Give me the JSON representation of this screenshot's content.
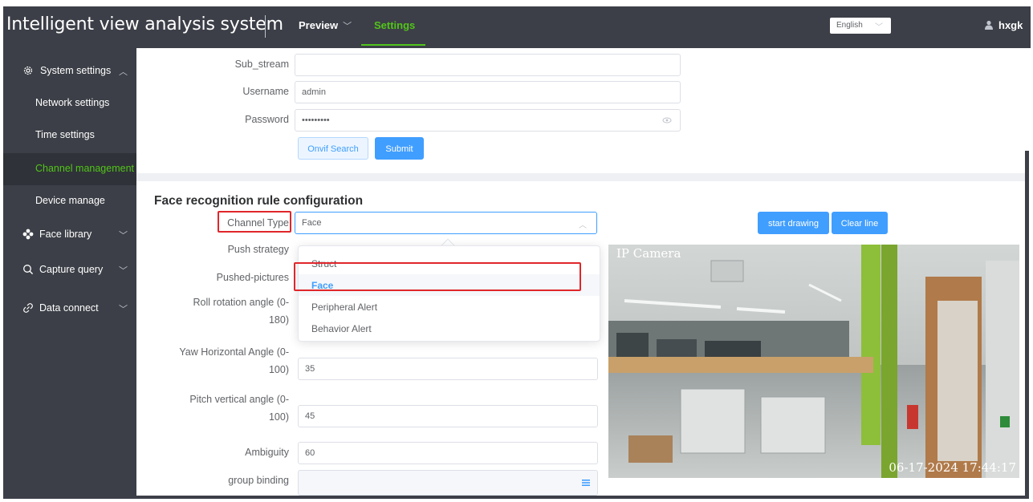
{
  "header": {
    "app_title": "Intelligent view analysis system",
    "nav_preview": "Preview",
    "nav_settings": "Settings",
    "language": "English",
    "username": "hxgk"
  },
  "sidebar": {
    "items": [
      {
        "label": "System settings",
        "icon": "gear-icon"
      },
      {
        "label": "Network settings"
      },
      {
        "label": "Time settings"
      },
      {
        "label": "Channel management"
      },
      {
        "label": "Device manage"
      },
      {
        "label": "Face library",
        "icon": "flower-icon"
      },
      {
        "label": "Capture query",
        "icon": "search-icon"
      },
      {
        "label": "Data connect",
        "icon": "link-icon"
      }
    ]
  },
  "stream_form": {
    "sub_stream_label": "Sub_stream",
    "sub_stream_value": "",
    "username_label": "Username",
    "username_value": "admin",
    "password_label": "Password",
    "password_value": "•••••••••",
    "onvif_button": "Onvif Search",
    "submit_button": "Submit"
  },
  "rule": {
    "title": "Face recognition rule configuration",
    "channel_type_label": "Channel Type",
    "channel_type_value": "Face",
    "push_strategy_label": "Push strategy",
    "pushed_pictures_label": "Pushed-pictures",
    "roll_label": "Roll rotation angle (0-180)",
    "yaw_label": "Yaw Horizontal Angle (0-100)",
    "yaw_value": "35",
    "pitch_label": "Pitch vertical angle (0-100)",
    "pitch_value": "45",
    "ambiguity_label": "Ambiguity",
    "ambiguity_value": "60",
    "group_binding_label": "group binding",
    "group_binding_value": "",
    "dropdown_options": [
      "Struct",
      "Face",
      "Peripheral Alert",
      "Behavior Alert"
    ],
    "dropdown_selected": "Face"
  },
  "video": {
    "start_drawing_button": "start drawing",
    "clear_line_button": "Clear line",
    "camera_title": "IP Camera",
    "timestamp": "06-17-2024 17:44:17"
  },
  "colors": {
    "header_bg": "#3c3f47",
    "accent_green": "#52c41a",
    "primary_blue": "#409eff",
    "annotation_red": "#e0262b"
  }
}
